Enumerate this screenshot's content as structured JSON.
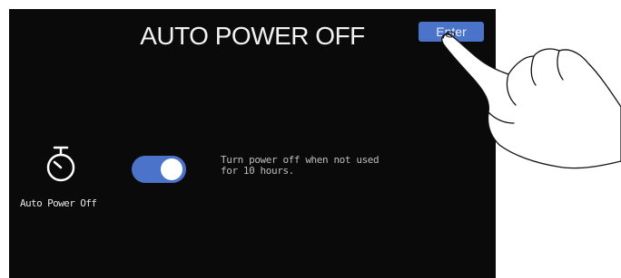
{
  "screen": {
    "title": "AUTO POWER OFF",
    "enter_button": {
      "label": "Enter"
    },
    "setting": {
      "icon": "stopwatch-icon",
      "label": "Auto Power Off",
      "toggle_state": "on",
      "description": "Turn power off when not used\nfor 10 hours."
    }
  },
  "colors": {
    "screen_background": "#0a0a0a",
    "accent": "#4b73c9",
    "text": "#f2f2f2"
  },
  "overlay": {
    "icon": "pointing-hand-icon"
  }
}
